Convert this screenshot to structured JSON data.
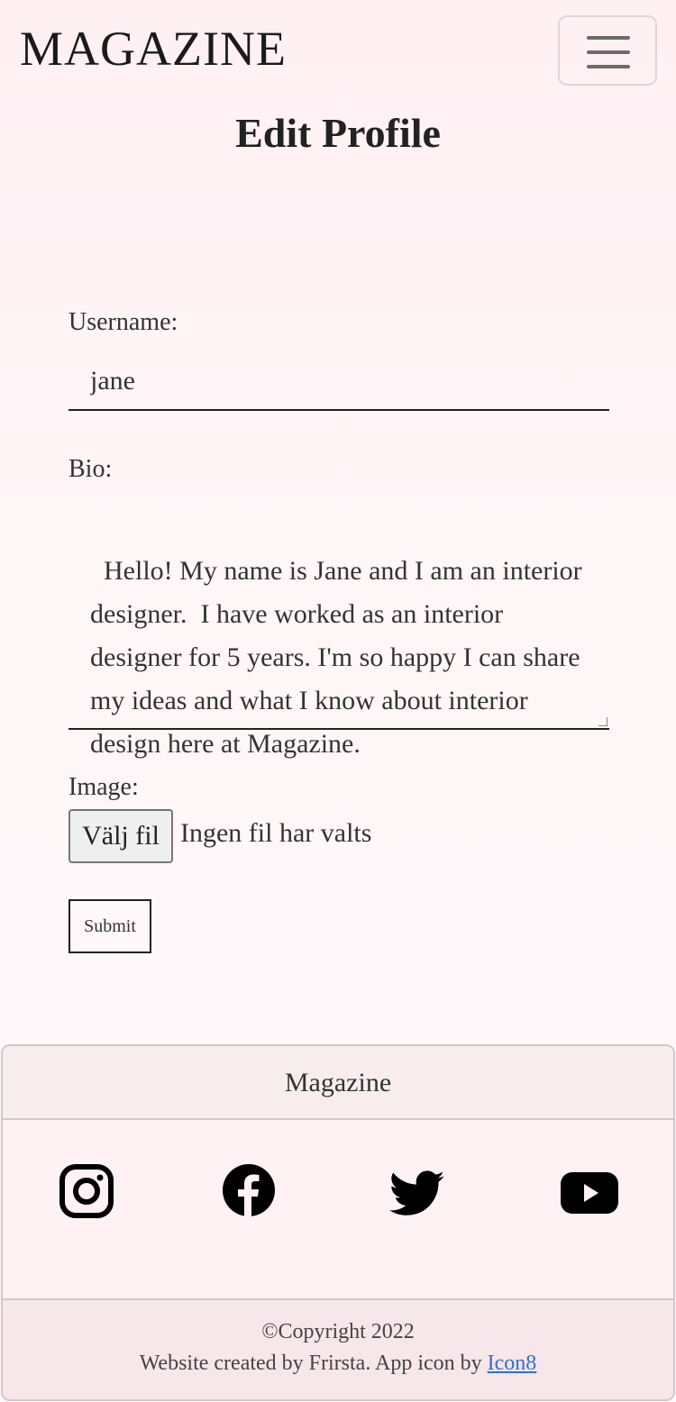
{
  "nav": {
    "brand": "MAGAZINE",
    "menu_icon": "hamburger-menu-icon"
  },
  "page": {
    "title": "Edit Profile"
  },
  "form": {
    "username_label": "Username:",
    "username_value": "jane",
    "bio_label": "Bio:",
    "bio_value": "Hello! My name is Jane and I am an interior designer.  I have worked as an interior designer for 5 years. I'm so happy I can share my ideas and what I know about interior design here at Magazine.",
    "image_label": "Image:",
    "file_button": "Välj fil",
    "file_status": "Ingen fil har valts",
    "submit": "Submit"
  },
  "footer": {
    "title": "Magazine",
    "social": [
      "instagram-icon",
      "facebook-icon",
      "twitter-icon",
      "youtube-icon"
    ],
    "copyright": "©Copyright 2022",
    "credits_prefix": "Website created by Frirsta. App icon by ",
    "credits_link": "Icon8"
  },
  "colors": {
    "link": "#2c6fdc",
    "background_top": "#fff0f4",
    "footer_bg": "#f7edef"
  }
}
